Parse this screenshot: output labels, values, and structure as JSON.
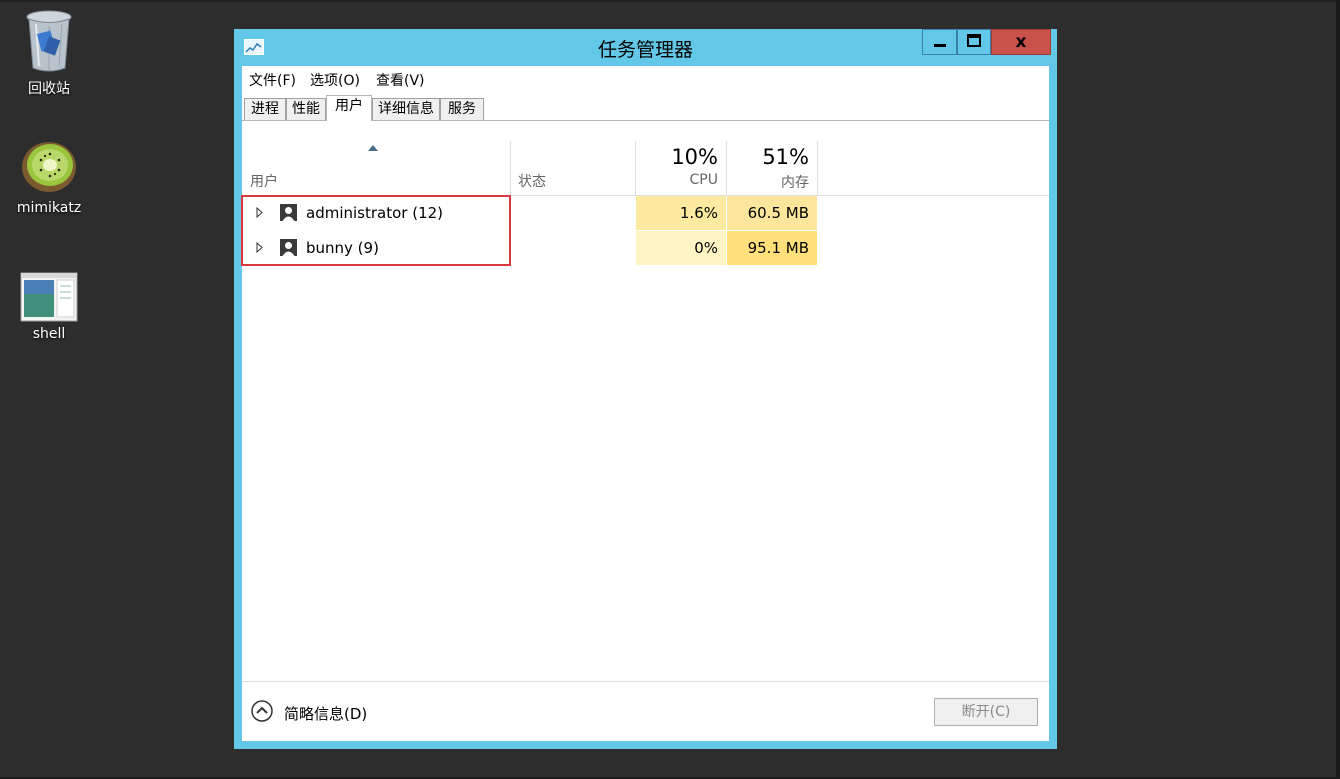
{
  "desktop": {
    "icons": [
      {
        "label": "回收站"
      },
      {
        "label": "mimikatz"
      },
      {
        "label": "shell"
      }
    ]
  },
  "window": {
    "title": "任务管理器",
    "controls": {
      "close_glyph": "x"
    },
    "menu": [
      "文件(F)",
      "选项(O)",
      "查看(V)"
    ],
    "tabs": [
      {
        "label": "进程",
        "active": false
      },
      {
        "label": "性能",
        "active": false
      },
      {
        "label": "用户",
        "active": true
      },
      {
        "label": "详细信息",
        "active": false
      },
      {
        "label": "服务",
        "active": false
      }
    ],
    "columns": {
      "user": {
        "label": "用户"
      },
      "status": {
        "label": "状态"
      },
      "cpu": {
        "total": "10%",
        "label": "CPU"
      },
      "memory": {
        "total": "51%",
        "label": "内存"
      }
    },
    "rows": [
      {
        "user": "administrator (12)",
        "status": "",
        "cpu": "1.6%",
        "memory": "60.5 MB"
      },
      {
        "user": "bunny (9)",
        "status": "",
        "cpu": "0%",
        "memory": "95.1 MB"
      }
    ],
    "footer": {
      "toggle_label": "简略信息(D)",
      "disconnect_label": "断开(C)"
    }
  },
  "colors": {
    "window_border": "#63c8e8",
    "close_button": "#c9524a",
    "highlight_box": "#d9383e",
    "cpu_low": "#fff4c4",
    "cpu_mid": "#fbeaa0",
    "mem_mid": "#fbe69c",
    "mem_high": "#ffe07a"
  }
}
